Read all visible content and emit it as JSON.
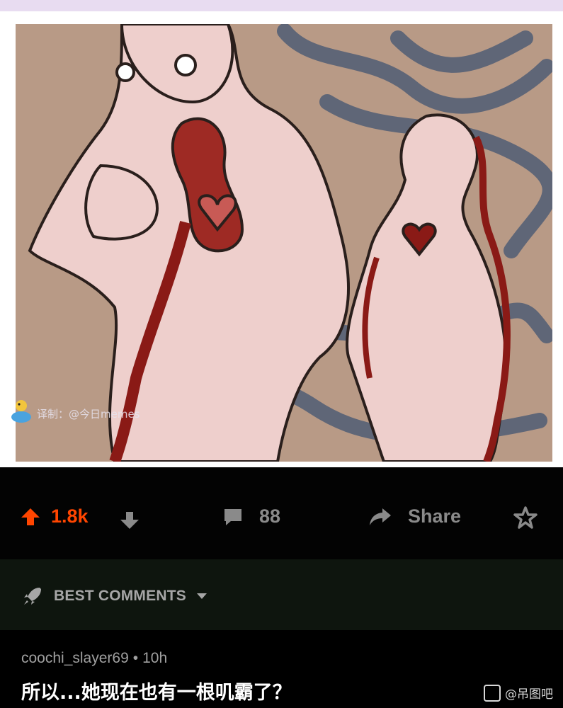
{
  "post": {
    "watermark": "译制：@今日memes"
  },
  "actions": {
    "upvote_count": "1.8k",
    "comment_count": "88",
    "share_label": "Share"
  },
  "sort": {
    "label": "BEST COMMENTS"
  },
  "comment": {
    "author": "coochi_slayer69",
    "separator": "•",
    "age": "10h",
    "text": "所以...她现在也有一根叽霸了？"
  },
  "source_watermark": {
    "label": "@吊图吧"
  },
  "colors": {
    "upvote": "#ff4500",
    "muted": "#8a8a8a",
    "background": "#030303"
  }
}
